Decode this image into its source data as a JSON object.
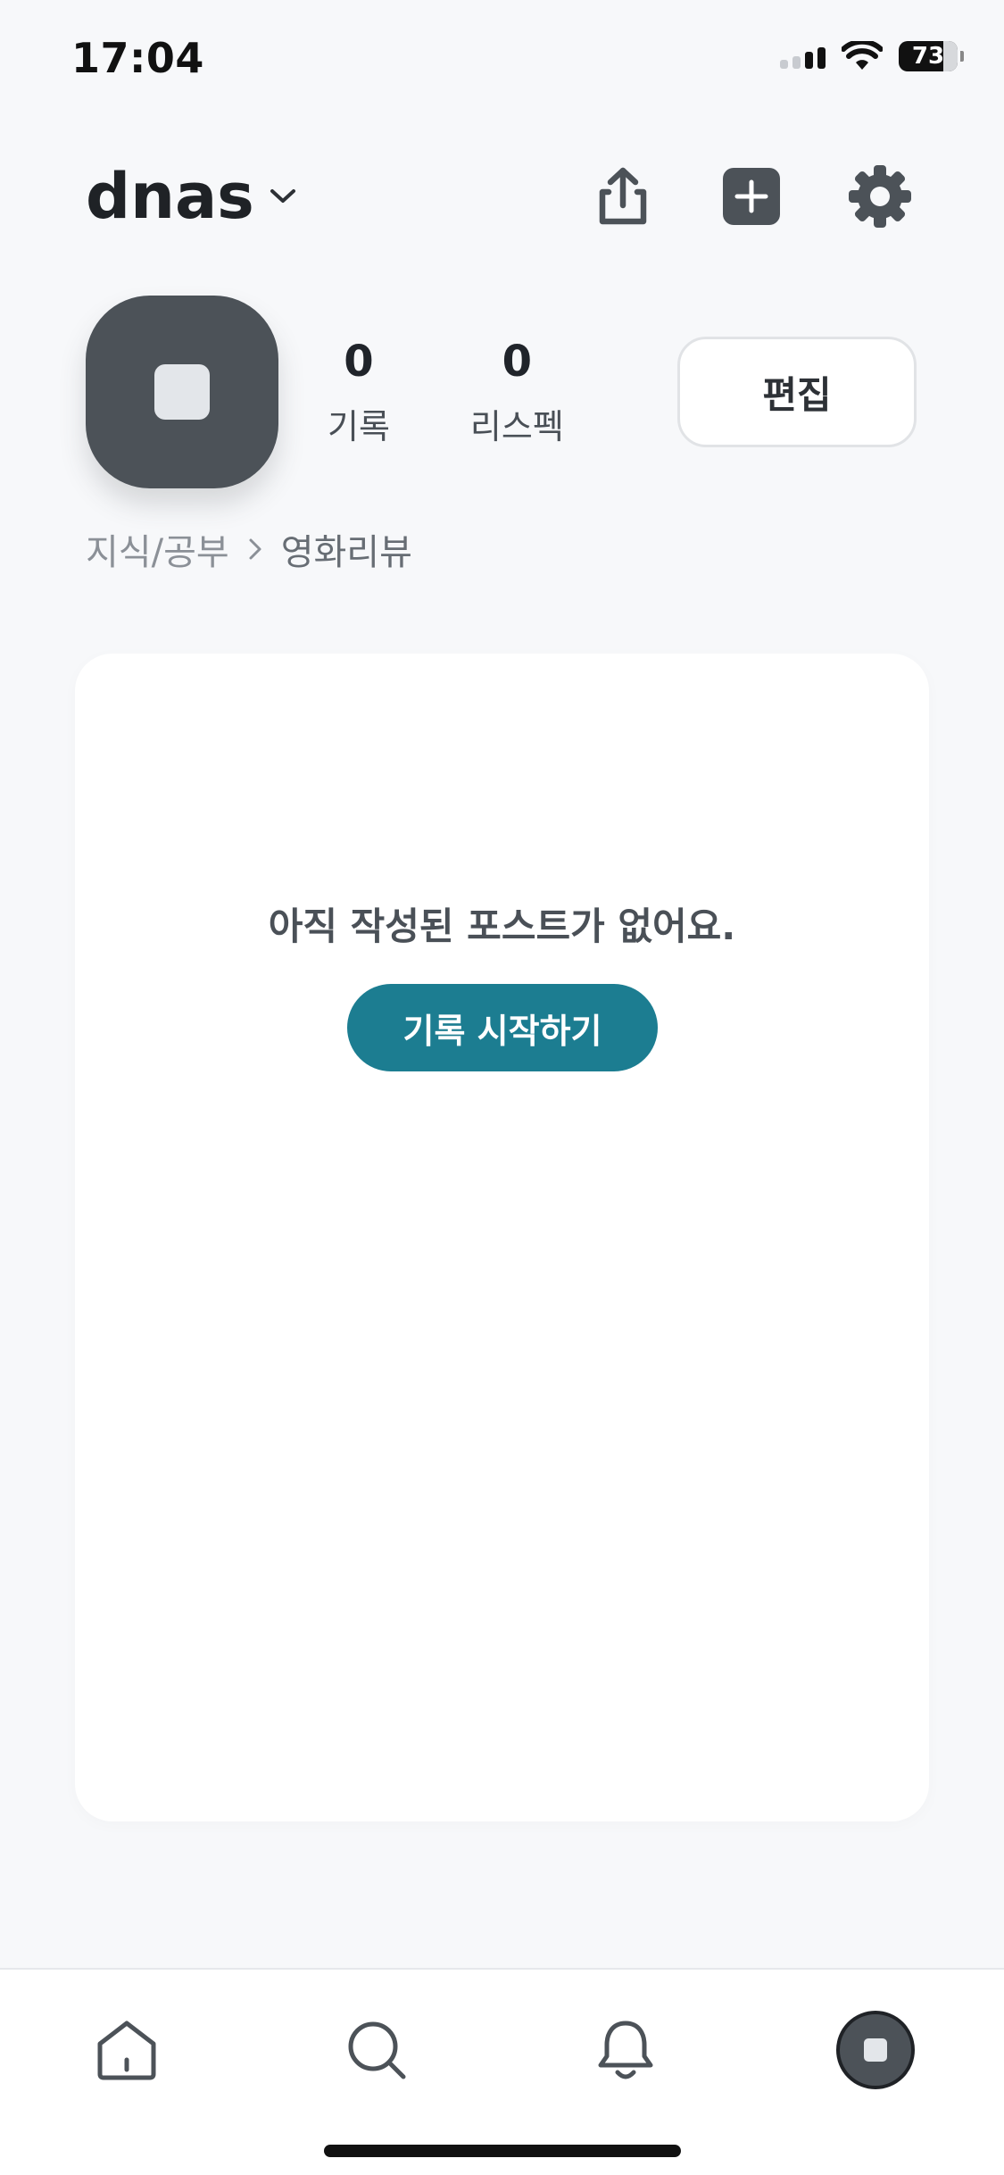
{
  "status_bar": {
    "time": "17:04",
    "battery": "73"
  },
  "header": {
    "account_name": "dnas",
    "icons": {
      "dropdown": "chevron-down-icon",
      "share": "share-icon",
      "add": "add-icon",
      "settings": "gear-icon"
    }
  },
  "profile": {
    "stats": [
      {
        "value": "0",
        "label": "기록"
      },
      {
        "value": "0",
        "label": "리스펙"
      }
    ],
    "edit_label": "편집"
  },
  "breadcrumb": {
    "parent": "지식/공부",
    "current": "영화리뷰"
  },
  "empty_state": {
    "message": "아직 작성된 포스트가 없어요.",
    "cta_label": "기록 시작하기"
  },
  "bottom_nav": {
    "items": [
      {
        "name": "home-icon"
      },
      {
        "name": "search-icon"
      },
      {
        "name": "bell-icon"
      },
      {
        "name": "profile-avatar"
      }
    ]
  },
  "colors": {
    "accent": "#1c7d91",
    "icon_dark": "#4c5258",
    "background": "#f7f8fa"
  }
}
